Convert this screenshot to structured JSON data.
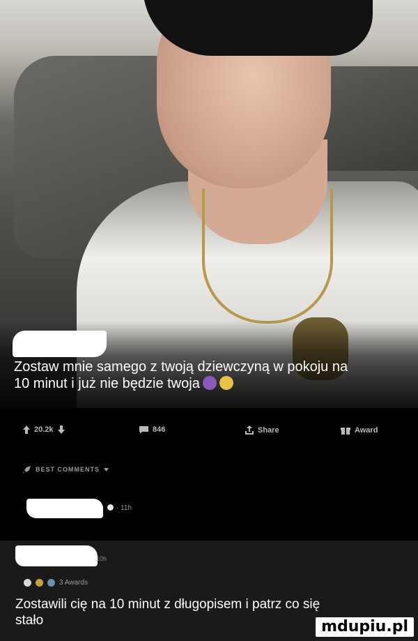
{
  "post": {
    "caption_line1": "Zostaw mnie samego z twoją dziewczyną w pokoju na",
    "caption_line2": "10 minut i już nie będzie twoja"
  },
  "actions": {
    "upvotes": "20.2k",
    "comments": "846",
    "share": "Share",
    "award": "Award"
  },
  "comments_header": "BEST COMMENTS",
  "comment1": {
    "age": "11h"
  },
  "comment2": {
    "age": "10h",
    "awards": "3 Awards",
    "text_line1": "Zostawili cię na 10 minut z długopisem i patrz co się",
    "text_line2": "stało"
  },
  "watermark": "mdupiu.pl",
  "colors": {
    "background": "#000000",
    "comment_bg": "#1a1a1b",
    "meta": "#9a9a9a"
  }
}
